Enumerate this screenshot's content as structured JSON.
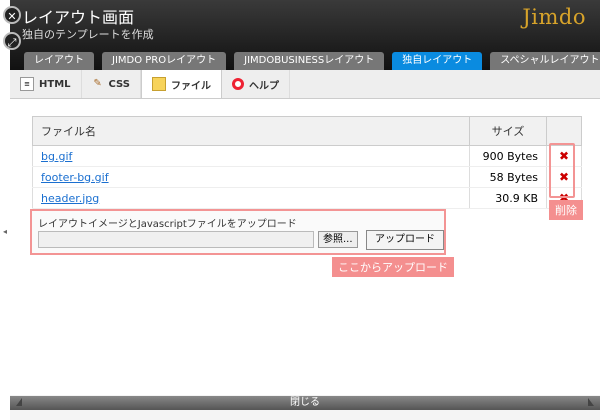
{
  "header": {
    "title": "レイアウト画面",
    "subtitle": "独自のテンプレートを作成",
    "logo": "Jimdo"
  },
  "tabs": [
    {
      "label": "レイアウト"
    },
    {
      "label": "JIMDO PROレイアウト"
    },
    {
      "label": "JIMDOBUSINESSレイアウト"
    },
    {
      "label": "独自レイアウト",
      "active": true
    },
    {
      "label": "スペシャルレイアウト"
    }
  ],
  "subtabs": [
    {
      "label": "HTML"
    },
    {
      "label": "CSS"
    },
    {
      "label": "ファイル",
      "active": true
    },
    {
      "label": "ヘルプ"
    }
  ],
  "table": {
    "headers": [
      "ファイル名",
      "サイズ"
    ],
    "rows": [
      {
        "name": "bg.gif",
        "size": "900 Bytes"
      },
      {
        "name": "footer-bg.gif",
        "size": "58 Bytes"
      },
      {
        "name": "header.jpg",
        "size": "30.9 KB"
      }
    ]
  },
  "annotations": {
    "delete_label": "削除",
    "upload_label": "ここからアップロード"
  },
  "upload": {
    "label": "レイアウトイメージとJavascriptファイルをアップロード",
    "browse": "参照...",
    "submit": "アップロード"
  },
  "footer": {
    "close": "閉じる"
  },
  "colors": {
    "active_tab": "#0a8be0",
    "annotation": "#f48f8f",
    "delete": "#cc0000"
  }
}
